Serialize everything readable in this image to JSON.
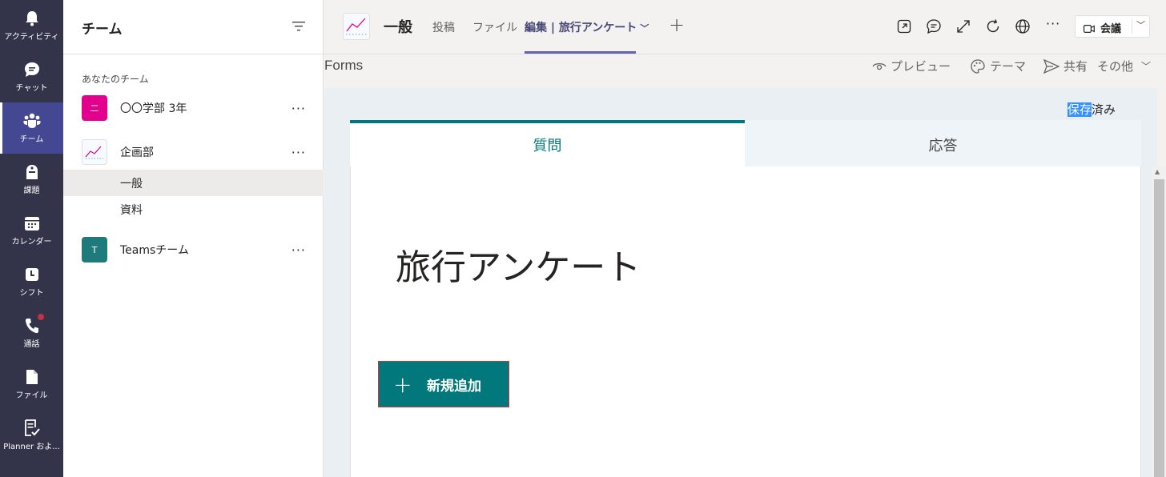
{
  "rail": {
    "items": [
      {
        "label": "アクティビティ",
        "icon": "bell-icon"
      },
      {
        "label": "チャット",
        "icon": "chat-icon"
      },
      {
        "label": "チーム",
        "icon": "teams-icon",
        "active": true
      },
      {
        "label": "課題",
        "icon": "assignments-icon"
      },
      {
        "label": "カレンダー",
        "icon": "calendar-icon"
      },
      {
        "label": "シフト",
        "icon": "shifts-icon"
      },
      {
        "label": "通話",
        "icon": "phone-icon",
        "badge": true
      },
      {
        "label": "ファイル",
        "icon": "file-icon"
      },
      {
        "label": "Planner およ...",
        "icon": "planner-icon"
      }
    ]
  },
  "panel": {
    "title": "チーム",
    "section_label": "あなたのチーム",
    "teams": [
      {
        "name": "〇〇学部 3年",
        "avatar_text": "二",
        "avatar_color": "#e3008c"
      },
      {
        "name": "企画部",
        "avatar_text": "",
        "avatar_color": "#f7fbff"
      },
      {
        "name": "Teamsチーム",
        "avatar_text": "T",
        "avatar_color": "#1f7a7c"
      }
    ],
    "channels": [
      "一般",
      "資料"
    ],
    "more_label": "···"
  },
  "header": {
    "channel_title": "一般",
    "tabs": [
      "投稿",
      "ファイル",
      "編集 | 旅行アンケート"
    ],
    "active_tab": 2,
    "add_tab": "+",
    "more": "···",
    "meet_label": "会議"
  },
  "forms": {
    "label": "Forms",
    "actions": [
      "プレビュー",
      "テーマ",
      "共有",
      "その他"
    ],
    "saved_highlight": "保存",
    "saved_rest": "済み",
    "tab_questions": "質問",
    "tab_responses": "応答",
    "title": "旅行アンケート",
    "add_button": "新規追加"
  },
  "colors": {
    "rail_bg": "#33344a",
    "accent": "#6264a7",
    "forms_teal": "#03787c"
  }
}
